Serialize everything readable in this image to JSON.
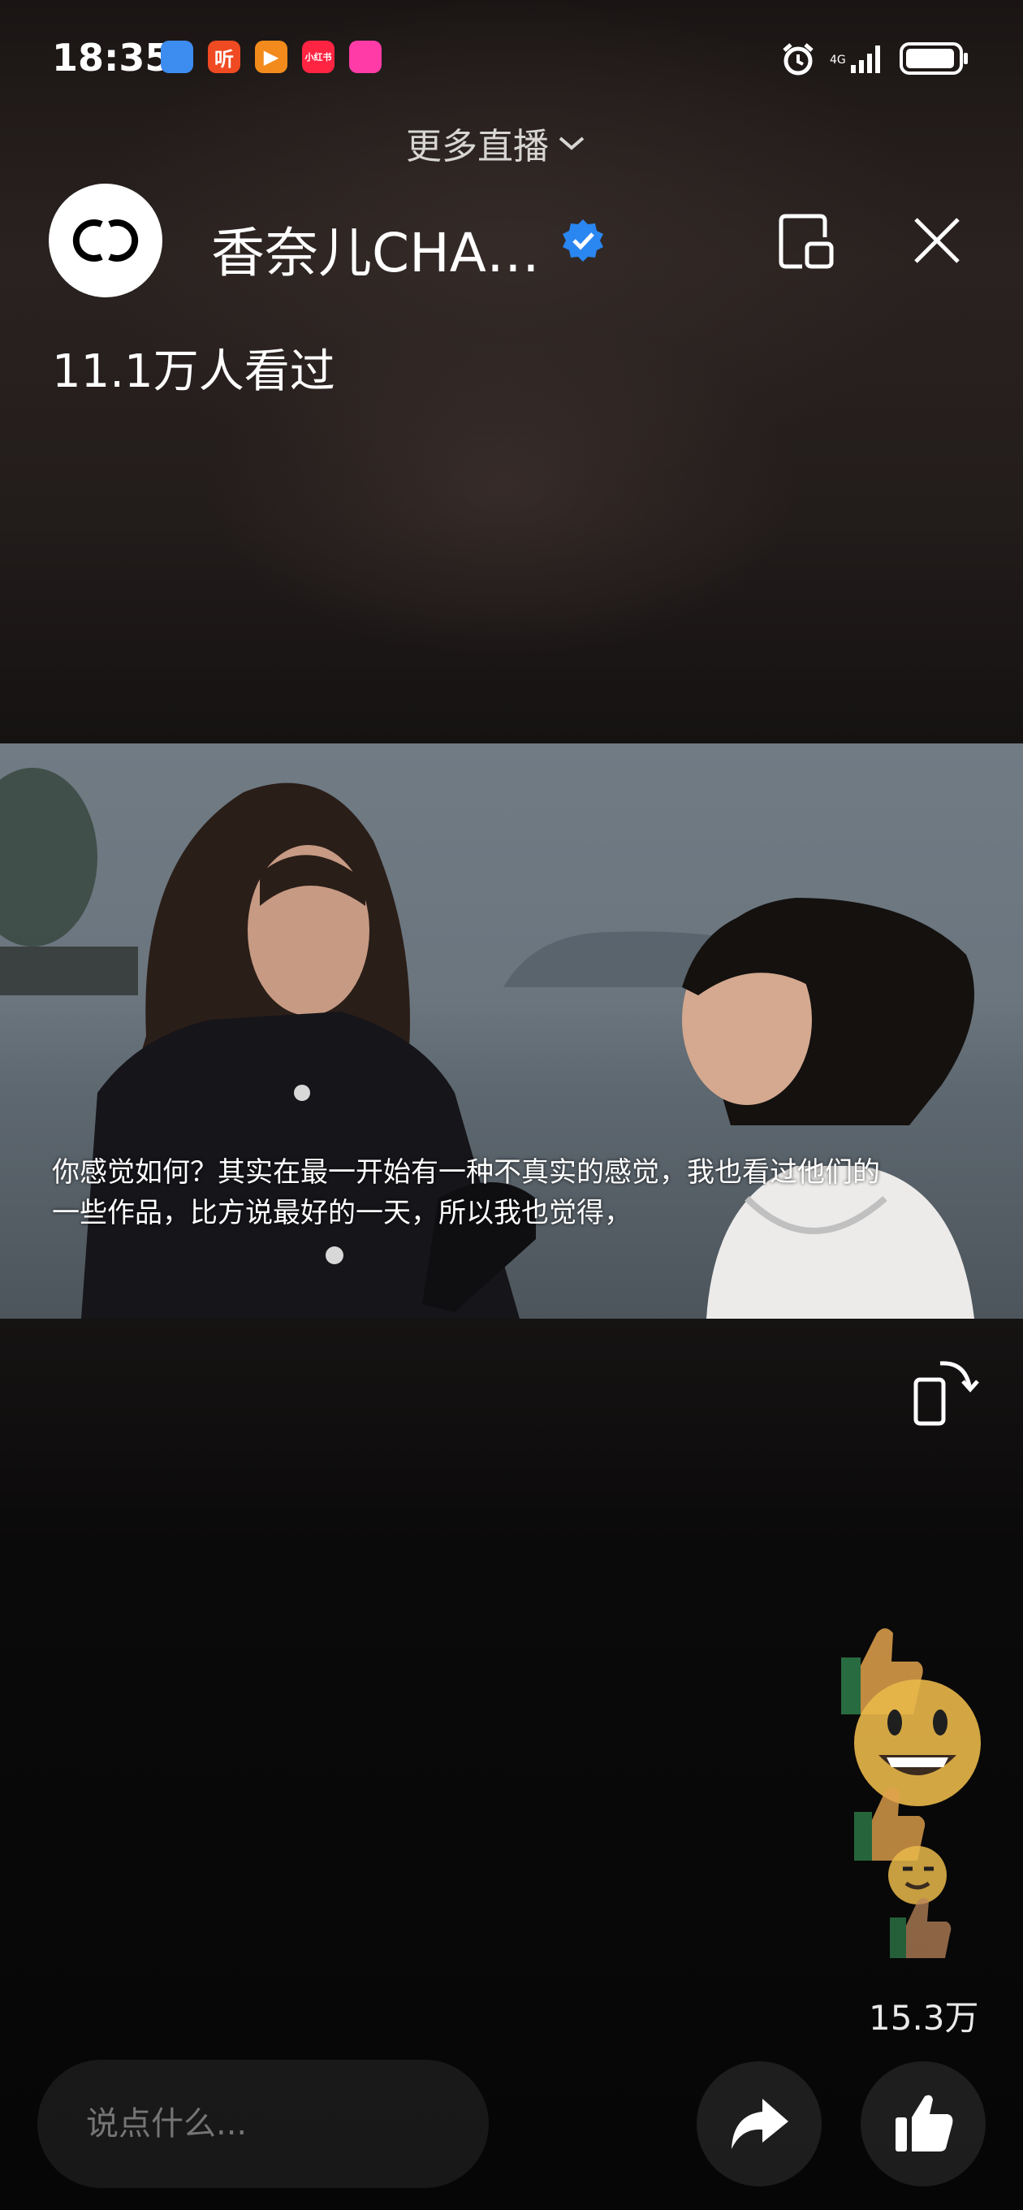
{
  "status_bar": {
    "time": "18:35",
    "app_badges": [
      {
        "name": "browser-app-badge",
        "label": "",
        "color": "#3d8cf0"
      },
      {
        "name": "listen-app-badge",
        "label": "听",
        "color": "#f04a23"
      },
      {
        "name": "video-app-badge",
        "label": "▶",
        "color": "#f28b1c"
      },
      {
        "name": "xiaohongshu-app-badge",
        "label": "小红书",
        "color": "#ff2442"
      },
      {
        "name": "shopping-app-badge",
        "label": "",
        "color": "#ff3ba7"
      }
    ],
    "battery_level": 0.95
  },
  "header": {
    "more_live_label": "更多直播",
    "channel_name": "香奈儿CHA…",
    "viewers_text": "11.1万人看过"
  },
  "video": {
    "subtitle_line1": "你感觉如何？其实在最一开始有一种不真实的感觉，我也看过他们的",
    "subtitle_line2": "一些作品，比方说最好的一天，所以我也觉得，"
  },
  "likes": {
    "count": "15.3万"
  },
  "bottom_bar": {
    "comment_placeholder": "说点什么..."
  },
  "colors": {
    "accent_verified": "#2a86f0",
    "background": "#080707"
  }
}
